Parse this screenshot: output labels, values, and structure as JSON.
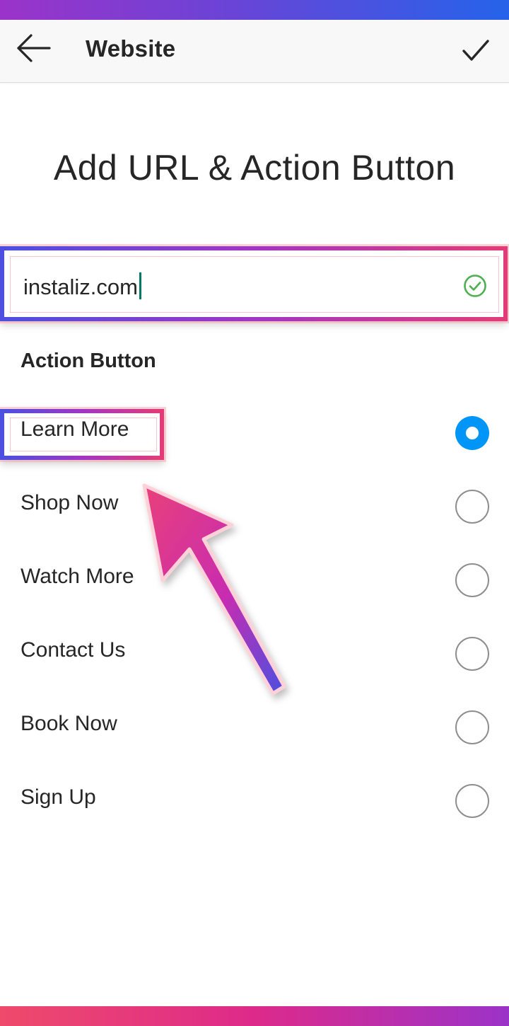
{
  "header": {
    "title": "Website"
  },
  "page": {
    "title": "Add URL & Action Button"
  },
  "url_input": {
    "value": "instaliz.com",
    "valid": true
  },
  "action_section": {
    "label": "Action Button",
    "options": [
      {
        "label": "Learn More",
        "selected": true
      },
      {
        "label": "Shop Now",
        "selected": false
      },
      {
        "label": "Watch More",
        "selected": false
      },
      {
        "label": "Contact Us",
        "selected": false
      },
      {
        "label": "Book Now",
        "selected": false
      },
      {
        "label": "Sign Up",
        "selected": false
      }
    ]
  },
  "icons": {
    "back": "arrow-left-icon",
    "confirm": "checkmark-icon",
    "valid": "check-circle-icon"
  },
  "colors": {
    "accent_blue": "#0095f6",
    "valid_green": "#4caf50",
    "caret": "#00796b",
    "gradient_start": "#4c4fe0",
    "gradient_end": "#e23c78"
  }
}
